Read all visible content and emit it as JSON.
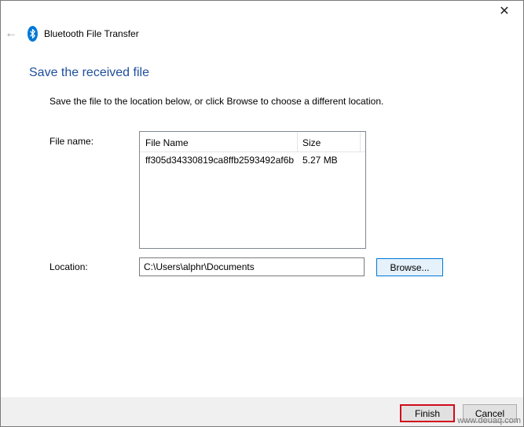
{
  "window": {
    "app_title": "Bluetooth File Transfer",
    "close_glyph": "✕",
    "back_glyph": "←"
  },
  "main": {
    "heading": "Save the received file",
    "instruction": "Save the file to the location below, or click Browse to choose a different location.",
    "file_name_label": "File name:",
    "columns": [
      "File Name",
      "Size"
    ],
    "files": [
      {
        "name": "ff305d34330819ca8ffb2593492af6b...",
        "size": "5.27 MB"
      }
    ],
    "location_label": "Location:",
    "location_value": "C:\\Users\\alphr\\Documents",
    "browse_label": "Browse..."
  },
  "footer": {
    "finish_label": "Finish",
    "cancel_label": "Cancel"
  },
  "watermark": "www.deuaq.com",
  "colors": {
    "heading": "#1f4e9c",
    "bluetooth": "#0078d7",
    "finish_highlight": "#d10b1b"
  },
  "icons": [
    "close-icon",
    "back-arrow-icon",
    "bluetooth-icon"
  ]
}
